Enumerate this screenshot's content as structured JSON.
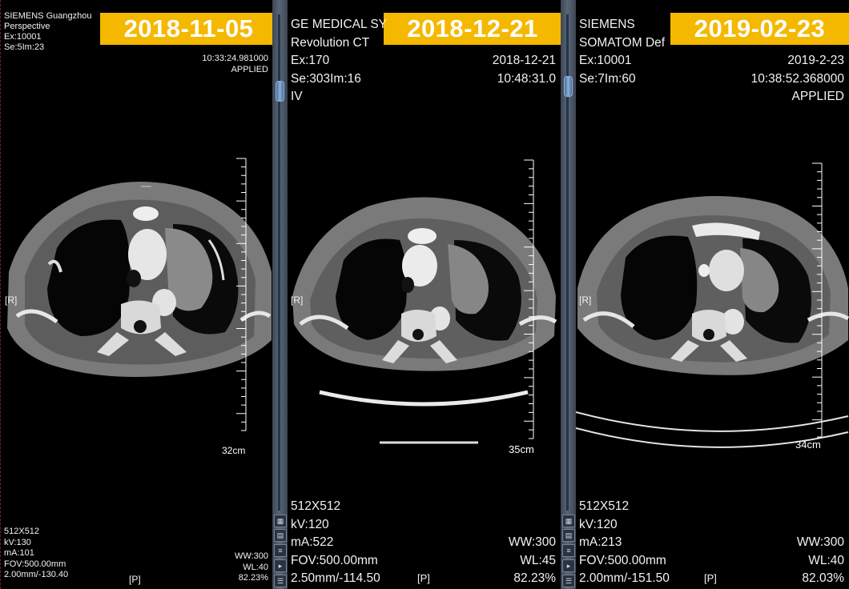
{
  "panels": [
    {
      "date": "2018-11-05",
      "top_left": [
        "SIEMENS  Guangzhou",
        "Perspective",
        "Ex:10001",
        "Se:5Im:23"
      ],
      "top_right": [
        "10:33:24.981000",
        "APPLIED"
      ],
      "orientation": "[R]",
      "scale": "32cm",
      "bottom_left": [
        "512X512",
        "kV:130",
        "mA:101",
        "FOV:500.00mm",
        "2.00mm/-130.40"
      ],
      "bottom_center": "[P]",
      "bottom_right": [
        "WW:300",
        "WL:40",
        "82.23%"
      ]
    },
    {
      "date": "2018-12-21",
      "top_left": [
        "GE MEDICAL SY",
        "Revolution CT",
        "Ex:170",
        "Se:303Im:16",
        "IV"
      ],
      "top_right": [
        "2018-12-21",
        "10:48:31.0"
      ],
      "orientation": "[R]",
      "scale": "35cm",
      "bottom_left": [
        "512X512",
        "kV:120",
        "mA:522",
        "FOV:500.00mm",
        "2.50mm/-114.50"
      ],
      "bottom_center": "[P]",
      "bottom_right": [
        "WW:300",
        "WL:45",
        "82.23%"
      ]
    },
    {
      "date": "2019-02-23",
      "top_left": [
        "SIEMENS",
        "SOMATOM Def",
        "Ex:10001",
        "Se:7Im:60"
      ],
      "top_right": [
        "2019-2-23",
        "10:38:52.368000",
        "APPLIED"
      ],
      "orientation": "[R]",
      "scale": "34cm",
      "bottom_left": [
        "512X512",
        "kV:120",
        "mA:213",
        "FOV:500.00mm",
        "2.00mm/-151.50"
      ],
      "bottom_center": "[P]",
      "bottom_right": [
        "WW:300",
        "WL:40",
        "82.03%"
      ]
    }
  ],
  "icons": [
    "scroll-thumb",
    "window-icon",
    "grid-icon",
    "play-icon",
    "list-icon"
  ]
}
